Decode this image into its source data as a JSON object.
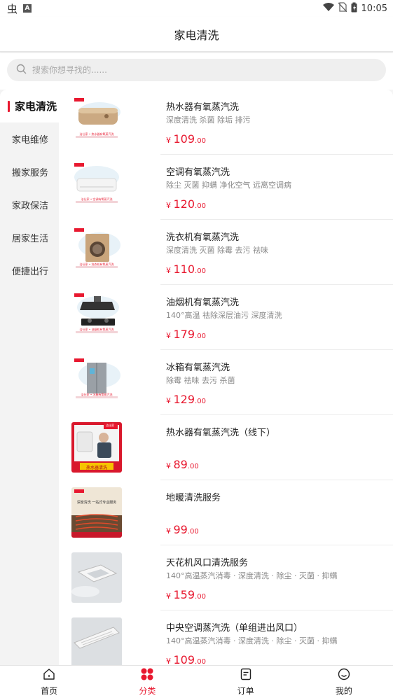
{
  "status_bar": {
    "time": "10:05",
    "app_glyph": "虫",
    "a_badge": "A"
  },
  "header": {
    "title": "家电清洗"
  },
  "search": {
    "placeholder": "搜索你想寻找的......"
  },
  "sidebar": {
    "items": [
      {
        "label": "家电清洗",
        "active": true
      },
      {
        "label": "家电维修"
      },
      {
        "label": "搬家服务"
      },
      {
        "label": "家政保洁"
      },
      {
        "label": "居家生活"
      },
      {
        "label": "便捷出行"
      }
    ]
  },
  "products": [
    {
      "name": "热水器有氧蒸汽洗",
      "desc": "深度清洗 杀菌 除垢 排污",
      "currency": "¥",
      "price_int": "109",
      "price_dec": ".00",
      "thumb_caption": "洁仕家 • 热水器有氧蒸汽洗",
      "thumb_brand": "洁仕家"
    },
    {
      "name": "空调有氧蒸汽洗",
      "desc": "除尘 灭菌 抑螨 净化空气 远离空调病",
      "currency": "¥",
      "price_int": "120",
      "price_dec": ".00",
      "thumb_caption": "洁仕家 • 空调有氧蒸汽洗",
      "thumb_brand": "洁仕家"
    },
    {
      "name": "洗衣机有氧蒸汽洗",
      "desc": "深度清洗 灭菌 除霉 去污 祛味",
      "currency": "¥",
      "price_int": "110",
      "price_dec": ".00",
      "thumb_caption": "洁仕家 • 洗衣机有氧蒸汽洗",
      "thumb_brand": "洁仕家"
    },
    {
      "name": "油烟机有氧蒸汽洗",
      "desc": "140°高温 祛除深层油污 深度清洗",
      "currency": "¥",
      "price_int": "179",
      "price_dec": ".00",
      "thumb_caption": "洁仕家 • 油烟机有氧蒸汽洗",
      "thumb_brand": "洁仕家"
    },
    {
      "name": "冰箱有氧蒸汽洗",
      "desc": "除霉 祛味 去污 杀菌",
      "currency": "¥",
      "price_int": "129",
      "price_dec": ".00",
      "thumb_caption": "洁仕家 • 冰箱有氧蒸汽洗",
      "thumb_brand": "洁仕家"
    },
    {
      "name": "热水器有氧蒸汽洗（线下）",
      "desc": "",
      "currency": "¥",
      "price_int": "89",
      "price_dec": ".00",
      "thumb_caption": "热水器清洗",
      "thumb_brand": "洁仕家"
    },
    {
      "name": "地暖清洗服务",
      "desc": "",
      "currency": "¥",
      "price_int": "99",
      "price_dec": ".00",
      "thumb_caption": "深度清洗 一站式专业服务",
      "thumb_brand": "洁仕家"
    },
    {
      "name": "天花机风口清洗服务",
      "desc": "140°高温蒸汽消毒 · 深度清洗 · 除尘 · 灭菌 · 抑螨",
      "currency": "¥",
      "price_int": "159",
      "price_dec": ".00",
      "thumb_caption": "",
      "thumb_brand": ""
    },
    {
      "name": "中央空调蒸汽洗（单组进出风口）",
      "desc": "140°高温蒸汽消毒 · 深度清洗 · 除尘 · 灭菌 · 抑螨",
      "currency": "¥",
      "price_int": "109",
      "price_dec": ".00",
      "thumb_caption": "",
      "thumb_brand": ""
    }
  ],
  "tabbar": {
    "items": [
      {
        "label": "首页",
        "icon": "home-icon"
      },
      {
        "label": "分类",
        "icon": "category-icon",
        "active": true
      },
      {
        "label": "订单",
        "icon": "order-icon"
      },
      {
        "label": "我的",
        "icon": "profile-icon"
      }
    ]
  },
  "colors": {
    "accent": "#e8182f",
    "sidebar_bg": "#f3f3f3",
    "page_bg": "#f5f5f5"
  }
}
